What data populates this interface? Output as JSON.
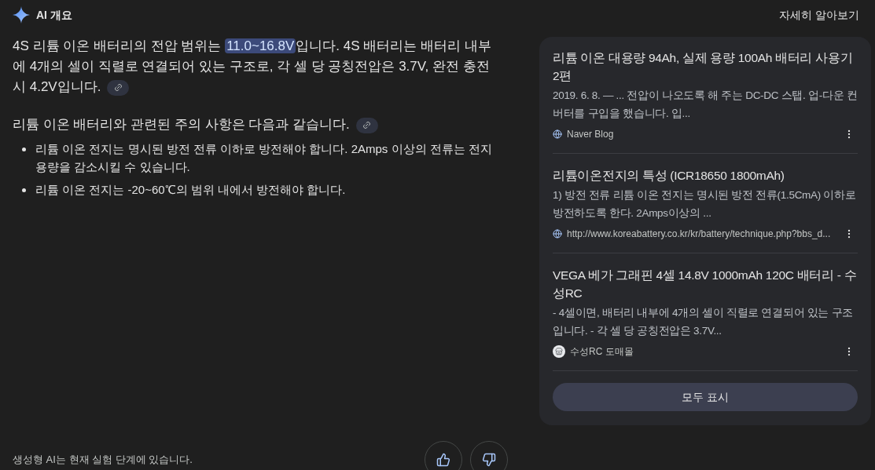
{
  "header": {
    "title": "AI 개요",
    "more_link": "자세히 알아보기"
  },
  "answer": {
    "paragraphs": [
      {
        "segments": [
          {
            "text": "4S 리튬 이온 배터리의 전압 범위는 ",
            "highlighted": false
          },
          {
            "text": "11.0~16.8V",
            "highlighted": true
          },
          {
            "text": "입니다. 4S 배터리는 배터리 내부에 4개의 셀이 직렬로 연결되어 있는 구조로, 각 셀 당 공칭전압은 3.7V, 완전 충전시 4.2V입니다.",
            "highlighted": false
          }
        ],
        "has_link": true
      },
      {
        "segments": [
          {
            "text": "리튬 이온 배터리와 관련된 주의 사항은 다음과 같습니다.",
            "highlighted": false
          }
        ],
        "has_link": true
      }
    ],
    "bullets": [
      "리튬 이온 전지는 명시된 방전 전류 이하로 방전해야 합니다. 2Amps 이상의 전류는 전지 용량을 감소시킬 수 있습니다.",
      "리튬 이온 전지는 -20~60℃의 범위 내에서 방전해야 합니다."
    ]
  },
  "sources": {
    "items": [
      {
        "title": "리튬 이온 대용량 94Ah, 실제 용량 100Ah 배터리 사용기 2편",
        "snippet": "2019. 6. 8. — ... 전압이 나오도록 해 주는 DC-DC 스탭. 업-다운 컨버터를 구입을 했습니다. 입...",
        "site": "Naver Blog",
        "kind": "globe"
      },
      {
        "title": "리튬이온전지의 특성 (ICR18650 1800mAh)",
        "snippet": "1) 방전 전류 리튬 이온 전지는 명시된 방전 전류(1.5CmA) 이하로 방전하도록 한다. 2Amps이상의 ...",
        "site": "http://www.koreabattery.co.kr/kr/battery/technique.php?bbs_d...",
        "kind": "globe"
      },
      {
        "title": "VEGA 베가 그래핀 4셀 14.8V 1000mAh 120C 배터리 - 수성RC",
        "snippet": "- 4셀이면, 배터리 내부에 4개의 셀이 직렬로 연결되어 있는 구조입니다. - 각 셀 당 공칭전압은 3.7V...",
        "site": "수성RC 도매몰",
        "kind": "store"
      }
    ],
    "show_all": "모두 표시"
  },
  "footer": {
    "disclaimer": "생성형 AI는 현재 실험 단계에 있습니다."
  }
}
